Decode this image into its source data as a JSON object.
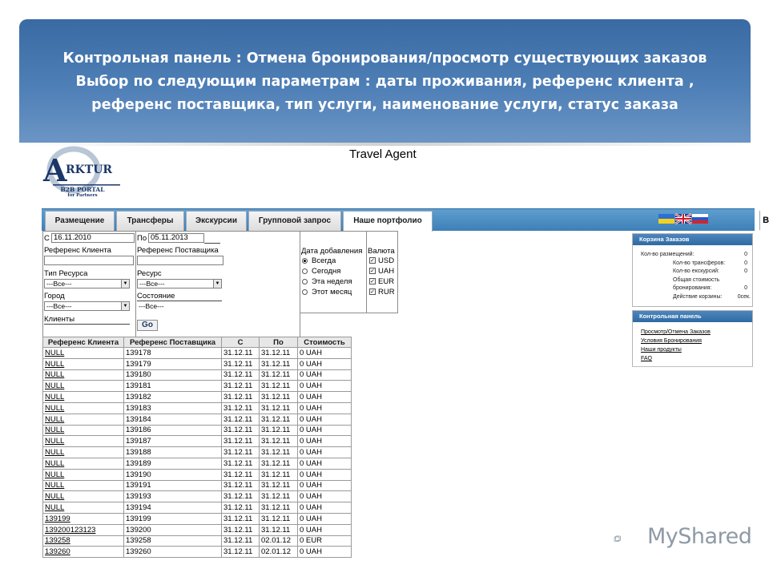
{
  "banner": {
    "line1": "Контрольная панель : Отмена бронирования/просмотр существующих заказов",
    "line2": "Выбор по следующим параметрам : даты проживания, референс клиента ,",
    "line3": "референс поставщика, тип услуги, наименование услуги, статус заказа"
  },
  "logo": {
    "b2b": "B2B PORTAL",
    "partners": "for Partners",
    "brand": "RKTUR",
    "letter": "A"
  },
  "site_title": "Travel Agent",
  "nav": {
    "tabs": [
      "Размещение",
      "Трансферы",
      "Экскурсии",
      "Групповой запрос",
      "Наше портфолио"
    ],
    "exit": "Выход"
  },
  "form": {
    "from_label": "С",
    "from_value": "16.11.2010",
    "to_label": "По",
    "to_value": "05.11.2013",
    "client_ref_label": "Референс Клиента",
    "supplier_ref_label": "Референс Поставщика",
    "resource_type_label": "Тип Ресурса",
    "resource_type_value": "---Все---",
    "resource_label": "Ресурс",
    "resource_value": "---Все---",
    "city_label": "Город",
    "city_value": "---Все---",
    "status_label": "Состояние",
    "status_value": "---Все---",
    "clients_label": "Клиенты",
    "go_label": "Go",
    "date_added_label": "Дата добавления",
    "date_options": [
      "Всегда",
      "Сегодня",
      "Эта неделя",
      "Этот месяц"
    ],
    "date_selected": "Всегда",
    "currency_label": "Валюта",
    "currencies": [
      "USD",
      "UAH",
      "EUR",
      "RUR"
    ]
  },
  "table": {
    "headers": [
      "Референс Клиента",
      "Референс Поставщика",
      "С",
      "По",
      "Стоимость"
    ],
    "rows": [
      [
        "NULL",
        "139178",
        "31.12.11",
        "31.12.11",
        "0 UAH"
      ],
      [
        "NULL",
        "139179",
        "31.12.11",
        "31.12.11",
        "0 UAH"
      ],
      [
        "NULL",
        "139180",
        "31.12.11",
        "31.12.11",
        "0 UAH"
      ],
      [
        "NULL",
        "139181",
        "31.12.11",
        "31.12.11",
        "0 UAH"
      ],
      [
        "NULL",
        "139182",
        "31.12.11",
        "31.12.11",
        "0 UAH"
      ],
      [
        "NULL",
        "139183",
        "31.12.11",
        "31.12.11",
        "0 UAH"
      ],
      [
        "NULL",
        "139184",
        "31.12.11",
        "31.12.11",
        "0 UAH"
      ],
      [
        "NULL",
        "139186",
        "31.12.11",
        "31.12.11",
        "0 UAH"
      ],
      [
        "NULL",
        "139187",
        "31.12.11",
        "31.12.11",
        "0 UAH"
      ],
      [
        "NULL",
        "139188",
        "31.12.11",
        "31.12.11",
        "0 UAH"
      ],
      [
        "NULL",
        "139189",
        "31.12.11",
        "31.12.11",
        "0 UAH"
      ],
      [
        "NULL",
        "139190",
        "31.12.11",
        "31.12.11",
        "0 UAH"
      ],
      [
        "NULL",
        "139191",
        "31.12.11",
        "31.12.11",
        "0 UAH"
      ],
      [
        "NULL",
        "139193",
        "31.12.11",
        "31.12.11",
        "0 UAH"
      ],
      [
        "NULL",
        "139194",
        "31.12.11",
        "31.12.11",
        "0 UAH"
      ],
      [
        "139199",
        "139199",
        "31.12.11",
        "31.12.11",
        "0 UAH"
      ],
      [
        "139200123123",
        "139200",
        "31.12.11",
        "31.12.11",
        "0 UAH"
      ],
      [
        "139258",
        "139258",
        "31.12.11",
        "02.01.12",
        "0 EUR"
      ],
      [
        "139260",
        "139260",
        "31.12.11",
        "02.01.12",
        "0 UAH"
      ]
    ]
  },
  "cart": {
    "title": "Корзина Заказов",
    "rows": [
      {
        "k": "Кол-во размещений:",
        "v": "0"
      },
      {
        "k": "Кол-во трансферов:",
        "v": "0"
      },
      {
        "k": "Кол-во екскурсий:",
        "v": "0"
      },
      {
        "k": "Общая стоимость",
        "v": ""
      },
      {
        "k": "бронирования:",
        "v": "0"
      },
      {
        "k": "Действие корзины:",
        "v": "0сек."
      }
    ]
  },
  "control_panel": {
    "title": "Контрольная панель",
    "links": [
      "Просмотр/Отмена Заказов",
      "Условия Бронирования",
      "Наши продукты",
      "FAQ"
    ]
  },
  "watermark": {
    "text": "MyShared"
  },
  "colors": {
    "banner": "#4a7bb2",
    "nav": "#3d7fb7",
    "side_head": "#2f6aa3"
  }
}
